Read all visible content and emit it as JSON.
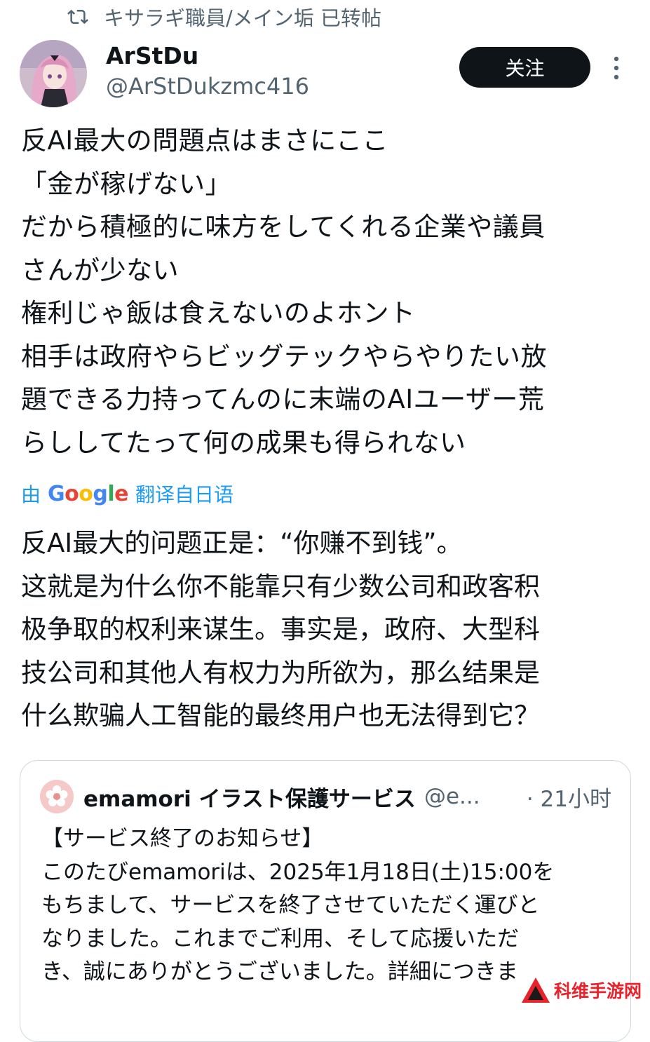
{
  "retweet": {
    "icon": "retweet-icon",
    "label": "キサラギ職員/メイン垢 已转帖"
  },
  "author": {
    "display_name": "ArStDu",
    "handle": "@ArStDukzmc416"
  },
  "follow_label": "关注",
  "tweet": {
    "lines": [
      "反AI最大の問題点はまさにここ",
      "「金が稼げない」",
      "だから積極的に味方をしてくれる企業や議員",
      "さんが少ない",
      "権利じゃ飯は食えないのよホント",
      "相手は政府やらビッグテックやらやりたい放",
      "題できる力持ってんのに末端のAIユーザー荒",
      "らししてたって何の成果も得られない"
    ]
  },
  "translation": {
    "prefix": "由",
    "provider": "Google",
    "suffix": "翻译自日语",
    "lines": [
      "反AI最大的问题正是：“你赚不到钱”。",
      "这就是为什么你不能靠只有少数公司和政客积",
      "极争取的权利来谋生。事实是，政府、大型科",
      "技公司和其他人有权力为所欲为，那么结果是",
      "什么欺骗人工智能的最终用户也无法得到它？"
    ]
  },
  "quote": {
    "name": "emamori イラスト保護サービス",
    "handle": "@e...",
    "time": "· 21小时",
    "lines": [
      "【サービス終了のお知らせ】",
      "このたびemamoriは、2025年1月18日(土)15:00を",
      "もちまして、サービスを終了させていただく運びと",
      "なりました。これまでご利用、そして応援いただ",
      "き、誠にありがとうございました。詳細につきま"
    ]
  },
  "watermark": {
    "text": "科维手游网"
  },
  "colors": {
    "text": "#0f1419",
    "secondary": "#536471",
    "link": "#1d9bf0",
    "button_bg": "#0f1419",
    "border": "#cfd9de",
    "watermark_red": "#e8212a"
  }
}
